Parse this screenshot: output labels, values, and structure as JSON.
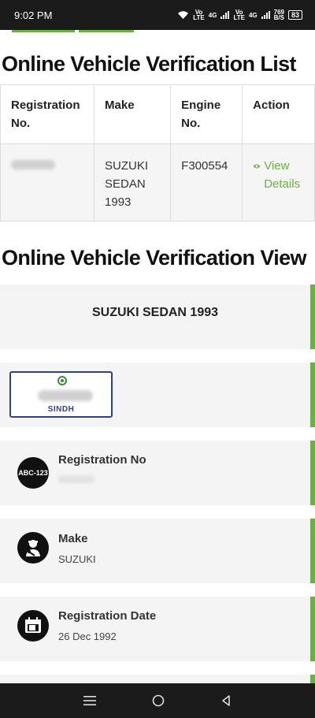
{
  "status_bar": {
    "time": "9:02 PM",
    "net1": {
      "top": "Vo",
      "bottom": "LTE",
      "gen": "4G"
    },
    "net2": {
      "top": "Vo",
      "bottom": "LTE",
      "gen": "4G"
    },
    "speed": {
      "top": "769",
      "bottom": "B/S"
    },
    "battery": "83"
  },
  "list_section": {
    "title": "Online Vehicle Verification List",
    "headers": [
      "Registration No.",
      "Make",
      "Engine No.",
      "Action"
    ],
    "row": {
      "make": "SUZUKI SEDAN 1993",
      "engine": "F300554",
      "action": "View Details"
    }
  },
  "view_section": {
    "title": "Online Vehicle Verification View",
    "vehicle_title": "SUZUKI SEDAN 1993",
    "plate": {
      "province": "SINDH"
    },
    "details": [
      {
        "icon_text": "ABC-123",
        "label": "Registration No",
        "value": ""
      },
      {
        "icon_text": "",
        "label": "Make",
        "value": "SUZUKI"
      },
      {
        "icon_text": "",
        "label": "Registration Date",
        "value": "26 Dec 1992"
      }
    ]
  },
  "colors": {
    "accent": "#6bb043",
    "plate_border": "#2f3f8f"
  }
}
